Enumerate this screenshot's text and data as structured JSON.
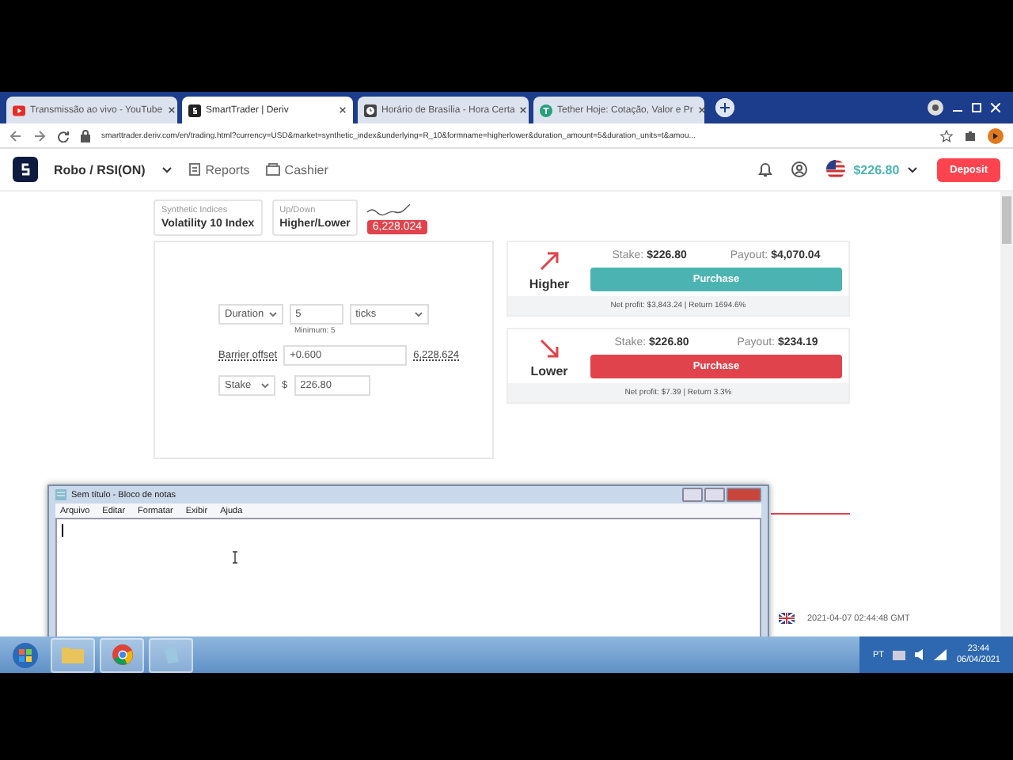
{
  "browser": {
    "tabs": [
      {
        "title": "Transmissão ao vivo - YouTube",
        "selected": false
      },
      {
        "title": "SmartTrader | Deriv",
        "selected": true
      },
      {
        "title": "Horário de Brasília - Hora Certa",
        "selected": false
      },
      {
        "title": "Tether Hoje: Cotação, Valor e Pr",
        "selected": false
      }
    ],
    "url": "smarttrader.deriv.com/en/trading.html?currency=USD&market=synthetic_index&underlying=R_10&formname=higherlower&duration_amount=5&duration_units=t&amou..."
  },
  "header": {
    "account": "Robo / RSI(ON)",
    "nav": [
      "Reports",
      "Cashier"
    ],
    "balance": "$226.80",
    "deposit": "Deposit"
  },
  "selectors": [
    {
      "label": "Synthetic Indices",
      "value": "Volatility 10 Index"
    },
    {
      "label": "Up/Down",
      "value": "Higher/Lower"
    }
  ],
  "spot": "6,228.024",
  "form": {
    "duration_select": "Duration",
    "duration_value": "5",
    "duration_unit": "ticks",
    "duration_hint": "Minimum: 5",
    "barrier_label": "Barrier offset",
    "barrier_value": "+0.600",
    "barrier_price": "6,228.624",
    "amount_select": "Stake",
    "currency": "$",
    "amount_value": "226.80"
  },
  "contracts": [
    {
      "kind": "higher",
      "label": "Higher",
      "stake_label": "Stake:",
      "stake": "$226.80",
      "payout_label": "Payout:",
      "payout": "$4,070.04",
      "button": "Purchase",
      "note": "Net profit: $3,843.24 | Return 1694.6%"
    },
    {
      "kind": "lower",
      "label": "Lower",
      "stake_label": "Stake:",
      "stake": "$226.80",
      "payout_label": "Payout:",
      "payout": "$234.19",
      "button": "Purchase",
      "note": "Net profit: $7.39 | Return 3.3%"
    }
  ],
  "footer": {
    "time": "2021-04-07 02:44:48 GMT"
  },
  "notepad": {
    "title": "Sem título - Bloco de notas",
    "menu": [
      "Arquivo",
      "Editar",
      "Formatar",
      "Exibir",
      "Ajuda"
    ]
  },
  "taskbar": {
    "language": "PT",
    "time": "23:44",
    "date": "06/04/2021"
  }
}
